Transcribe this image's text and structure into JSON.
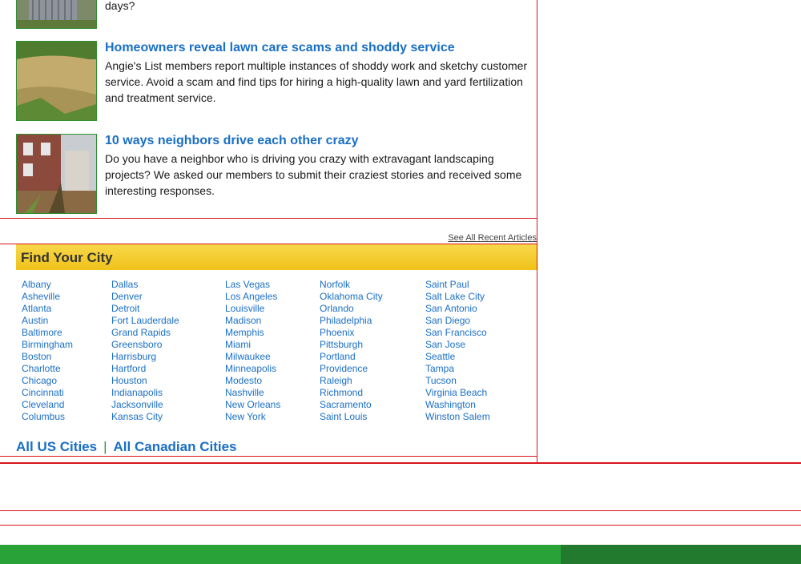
{
  "articles": [
    {
      "title": "",
      "body": "days?"
    },
    {
      "title": "Homeowners reveal lawn care scams and shoddy service",
      "body": "Angie's List members report multiple instances of shoddy work and sketchy customer service. Avoid a scam and find tips for hiring a high-quality lawn and yard fertilization and treatment service."
    },
    {
      "title": "10 ways neighbors drive each other crazy",
      "body": "Do you have a neighbor who is driving you crazy with extravagant landscaping projects? We asked our members to submit their craziest stories and received some interesting responses."
    }
  ],
  "see_all_label": "See All Recent Articles",
  "find_city": {
    "heading": "Find Your City",
    "columns": [
      [
        "Albany",
        "Asheville",
        "Atlanta",
        "Austin",
        "Baltimore",
        "Birmingham",
        "Boston",
        "Charlotte",
        "Chicago",
        "Cincinnati",
        "Cleveland",
        "Columbus"
      ],
      [
        "Dallas",
        "Denver",
        "Detroit",
        "Fort Lauderdale",
        "Grand Rapids",
        "Greensboro",
        "Harrisburg",
        "Hartford",
        "Houston",
        "Indianapolis",
        "Jacksonville",
        "Kansas City"
      ],
      [
        "Las Vegas",
        "Los Angeles",
        "Louisville",
        "Madison",
        "Memphis",
        "Miami",
        "Milwaukee",
        "Minneapolis",
        "Modesto",
        "Nashville",
        "New Orleans",
        "New York"
      ],
      [
        "Norfolk",
        "Oklahoma City",
        "Orlando",
        "Philadelphia",
        "Phoenix",
        "Pittsburgh",
        "Portland",
        "Providence",
        "Raleigh",
        "Richmond",
        "Sacramento",
        "Saint Louis"
      ],
      [
        "Saint Paul",
        "Salt Lake City",
        "San Antonio",
        "San Diego",
        "San Francisco",
        "San Jose",
        "Seattle",
        "Tampa",
        "Tucson",
        "Virginia Beach",
        "Washington",
        "Winston Salem"
      ]
    ],
    "all_us": "All US Cities",
    "separator": "|",
    "all_canadian": "All Canadian Cities"
  },
  "colors": {
    "link": "#1a6fc4",
    "rule": "#d9141c",
    "footer_green": "#29a338",
    "footer_dark": "#217a2e"
  }
}
